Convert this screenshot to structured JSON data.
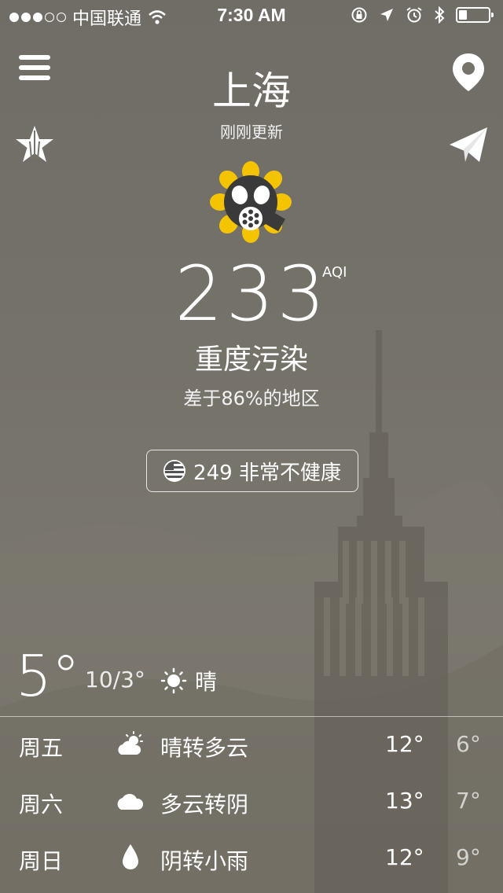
{
  "status_bar": {
    "carrier": "中国联通",
    "time": "7:30 AM"
  },
  "header": {
    "city": "上海",
    "updated": "刚刚更新"
  },
  "aqi": {
    "value": "233",
    "unit": "AQI",
    "level": "重度污染",
    "rank": "差于86%的地区",
    "us_aqi": "249 非常不健康"
  },
  "current_weather": {
    "temp": "5°",
    "range": "10/3°",
    "condition": "晴",
    "icon": "sun-icon"
  },
  "forecast": [
    {
      "day": "周五",
      "icon": "partly-cloudy-icon",
      "condition": "晴转多云",
      "high": "12°",
      "low": "6°"
    },
    {
      "day": "周六",
      "icon": "cloud-icon",
      "condition": "多云转阴",
      "high": "13°",
      "low": "7°"
    },
    {
      "day": "周日",
      "icon": "raindrop-icon",
      "condition": "阴转小雨",
      "high": "12°",
      "low": "9°"
    }
  ],
  "colors": {
    "background": "#75726a",
    "mascot_yellow": "#f5c400",
    "mascot_mask": "#3a3a3a"
  }
}
